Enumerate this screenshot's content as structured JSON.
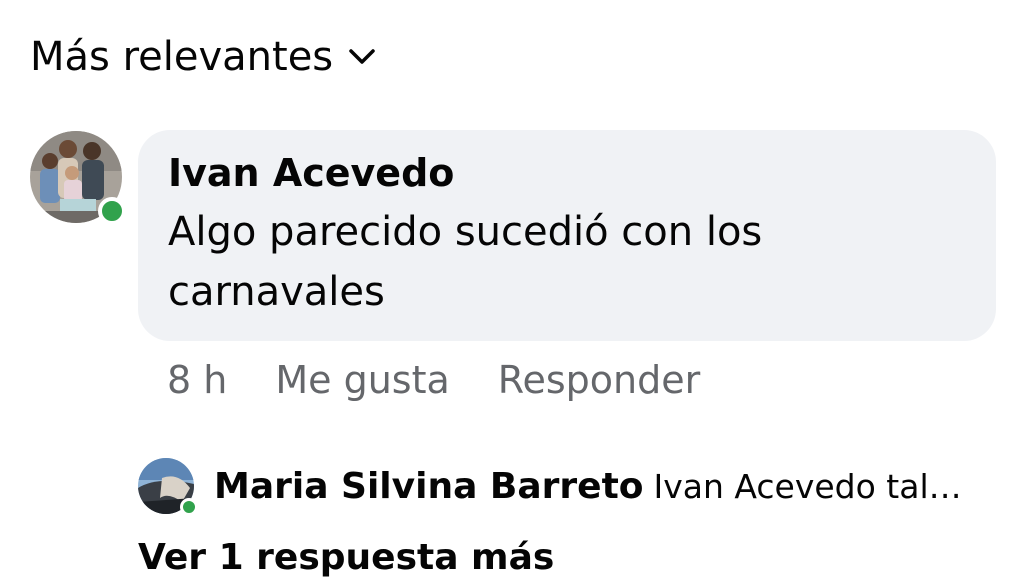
{
  "sort": {
    "label": "Más relevantes",
    "icon": "chevron-down-icon"
  },
  "comment": {
    "author": "Ivan Acevedo",
    "text": "Algo parecido sucedió con los carnavales",
    "time": "8 h",
    "like_label": "Me gusta",
    "reply_label": "Responder",
    "online": true
  },
  "reply": {
    "author": "Maria Silvina Barreto",
    "preview": "Ivan Acevedo tal…",
    "online": true
  },
  "more_replies_label": "Ver 1 respuesta más",
  "colors": {
    "bubble": "#f0f2f5",
    "online": "#31a24c",
    "meta_text": "#65676b",
    "text": "#050505"
  }
}
